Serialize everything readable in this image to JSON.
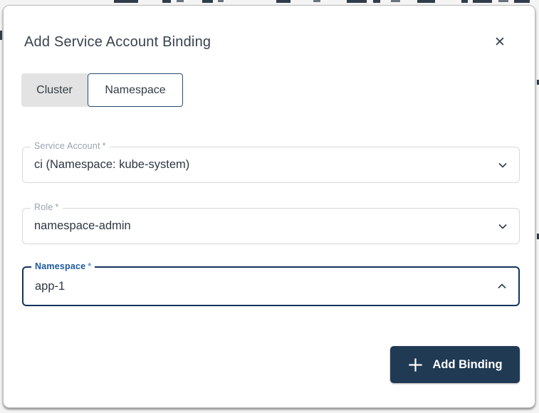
{
  "colors": {
    "accent_navy": "#203a54",
    "focus_border": "#14335f",
    "focused_label_blue": "#1d5aa0",
    "idle_label_gray": "#98a2ae",
    "field_border": "#d8d8d8",
    "tab_selected_border": "#2b4a6e",
    "tab_unselected_bg": "#e3e3e3",
    "title_text": "#39434e"
  },
  "dialog": {
    "title": "Add Service Account Binding",
    "close_icon": "✕"
  },
  "tabs": {
    "cluster_label": "Cluster",
    "namespace_label": "Namespace",
    "selected": "Namespace"
  },
  "fields": {
    "service_account": {
      "label": "Service Account",
      "required_mark": "*",
      "value": "ci (Namespace: kube-system)",
      "state": "collapsed"
    },
    "role": {
      "label": "Role",
      "required_mark": "*",
      "value": "namespace-admin",
      "state": "collapsed"
    },
    "namespace": {
      "label": "Namespace",
      "required_mark": "*",
      "value": "app-1",
      "state": "expanded-focused"
    }
  },
  "footer": {
    "add_binding_label": "Add Binding"
  }
}
